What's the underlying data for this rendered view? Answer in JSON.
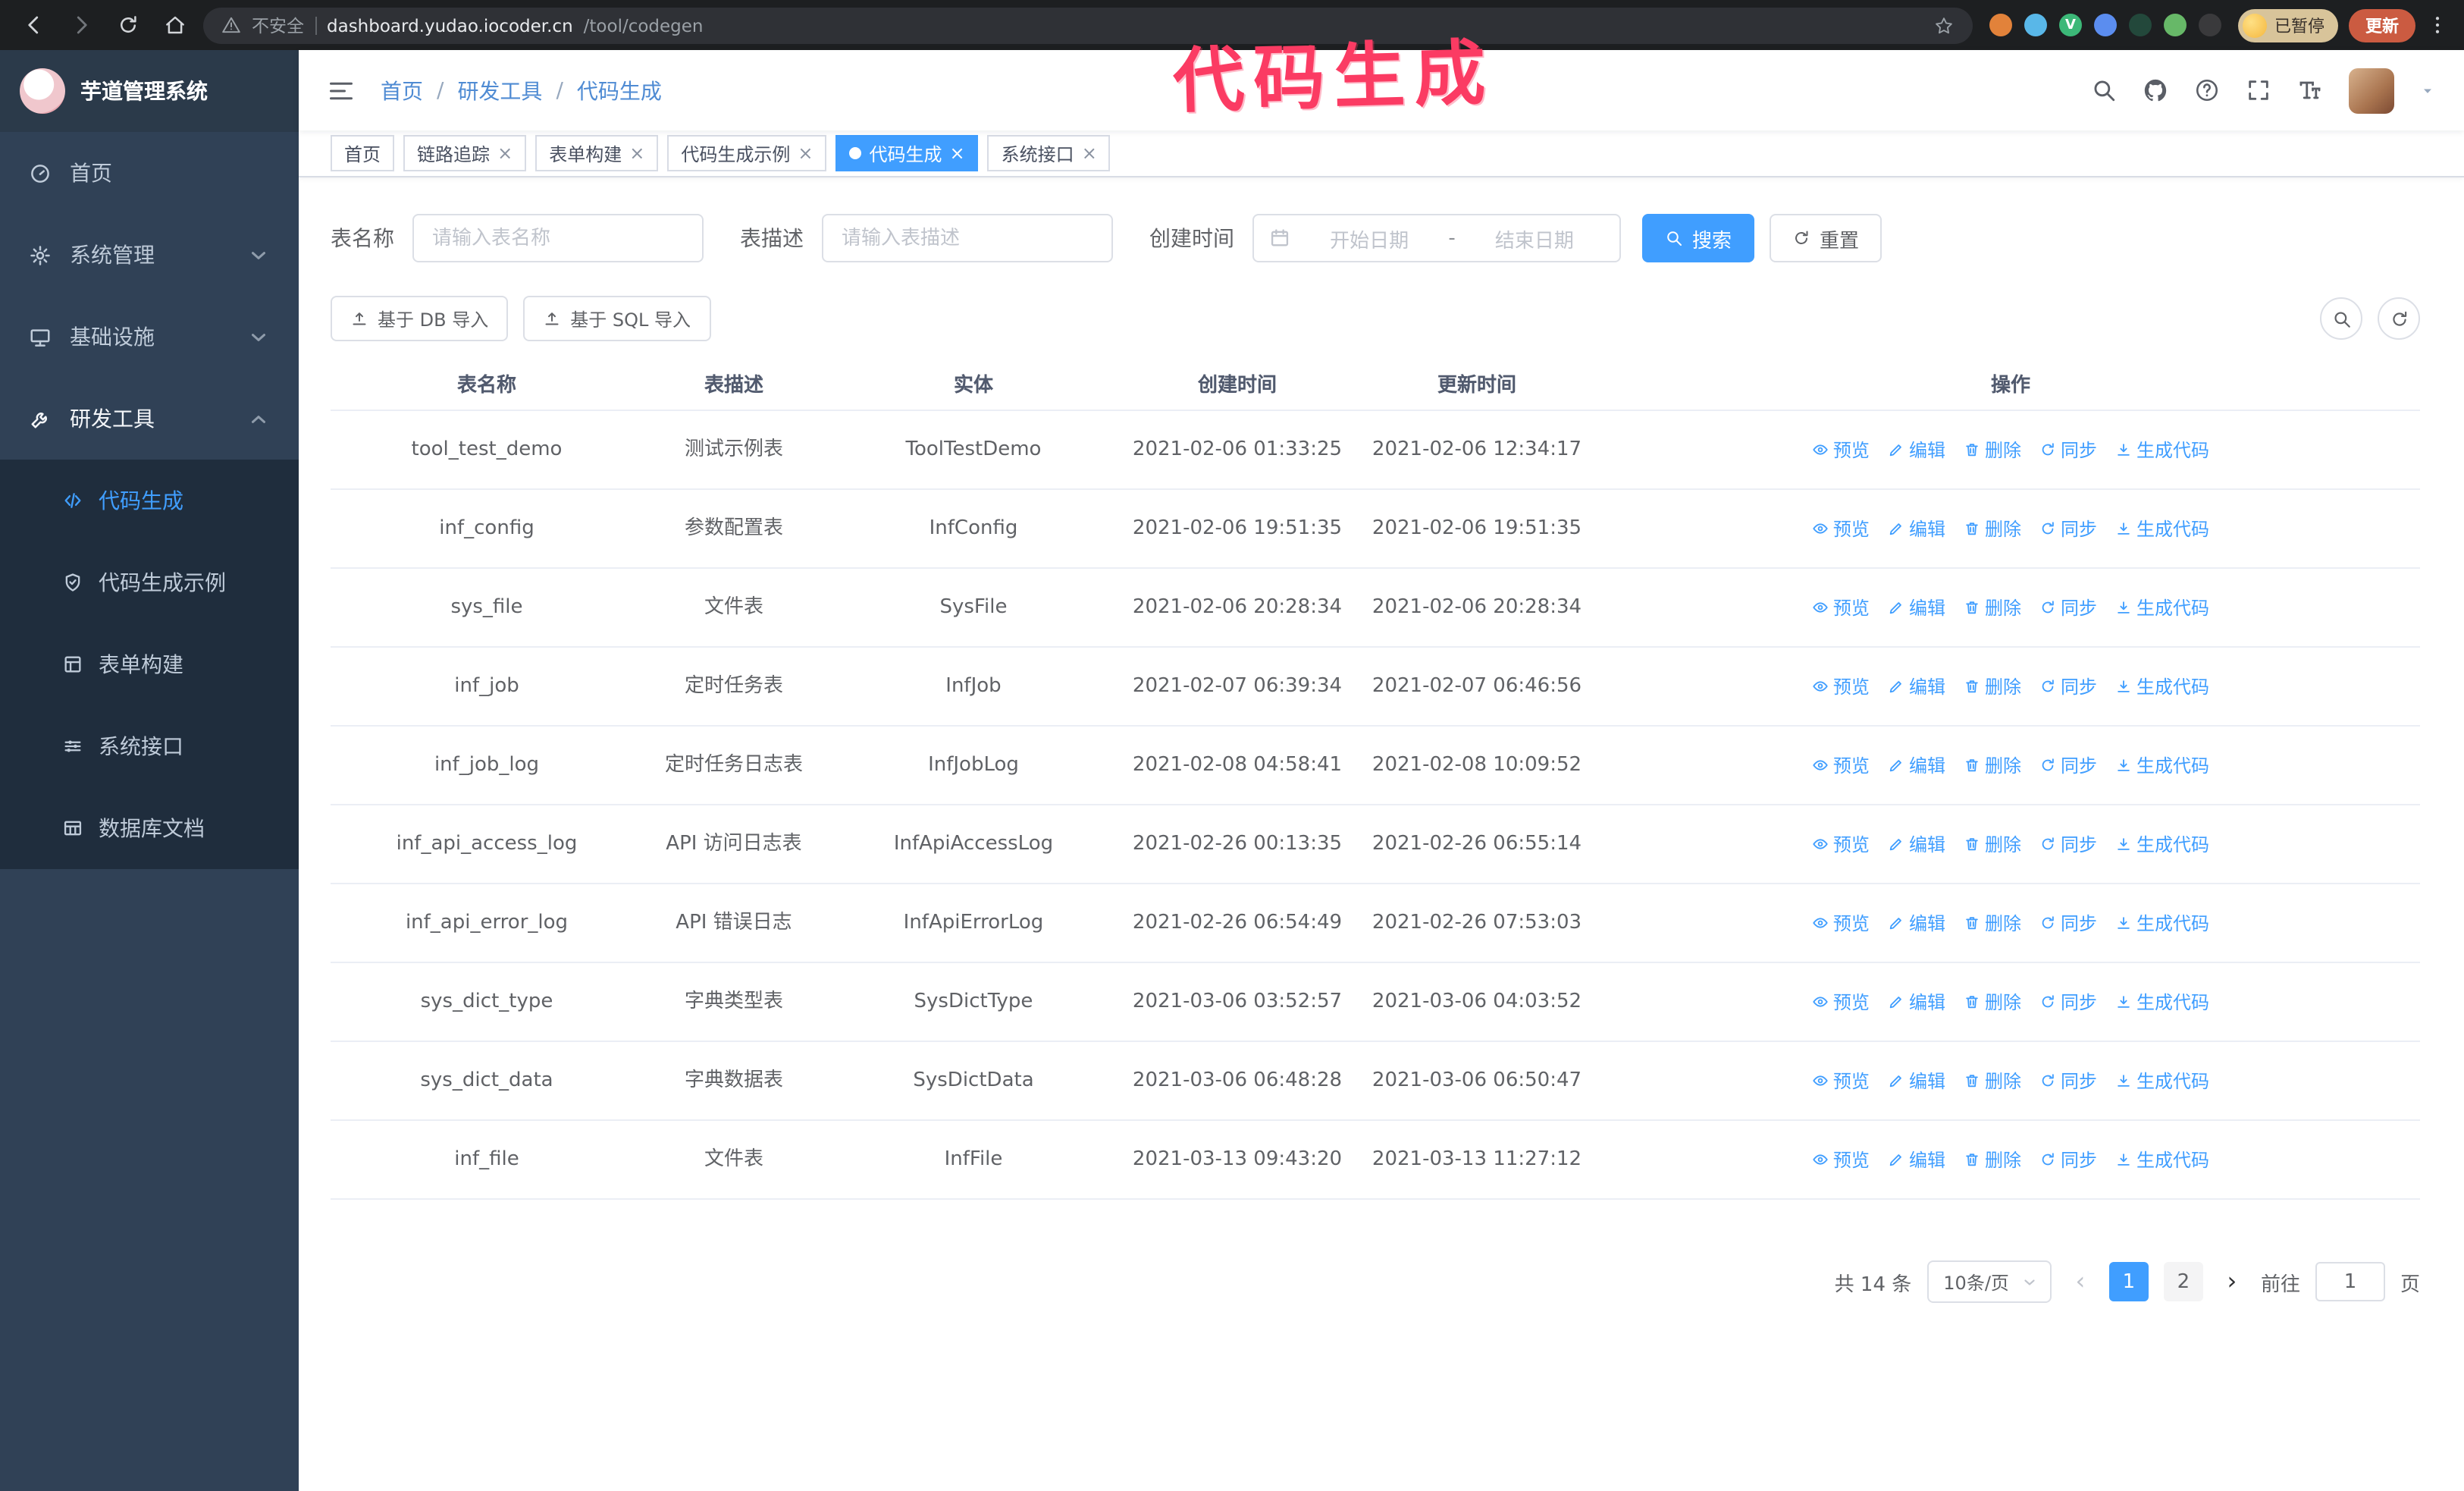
{
  "theme": {
    "accent": "#409eff",
    "sidebar_bg": "#304156",
    "submenu_bg": "#1f2d3d",
    "annotation_color": "#fb3b63"
  },
  "annotation": {
    "text": "代码生成"
  },
  "browser": {
    "security_label": "不安全",
    "url_host": "dashboard.yudao.iocoder.cn",
    "url_path": "/tool/codegen",
    "profile_badge": "已暂停",
    "update_button": "更新",
    "extensions": [
      {
        "name": "fox",
        "color": "#e2823a",
        "glyph": ""
      },
      {
        "name": "drop",
        "color": "#59b7e8",
        "glyph": ""
      },
      {
        "name": "v-circle",
        "color": "#3cb878",
        "glyph": "V"
      },
      {
        "name": "grid",
        "color": "#5b8def",
        "glyph": ""
      },
      {
        "name": "capture",
        "color": "#23483b",
        "glyph": ""
      },
      {
        "name": "leaf",
        "color": "#67b868",
        "glyph": ""
      },
      {
        "name": "pin",
        "color": "#3a3a3c",
        "glyph": ""
      }
    ]
  },
  "sidebar": {
    "logo_title": "芋道管理系统",
    "menu": [
      {
        "label": "首页"
      },
      {
        "label": "系统管理"
      },
      {
        "label": "基础设施"
      },
      {
        "label": "研发工具"
      }
    ],
    "submenu": [
      {
        "label": "代码生成",
        "active": true
      },
      {
        "label": "代码生成示例"
      },
      {
        "label": "表单构建"
      },
      {
        "label": "系统接口"
      },
      {
        "label": "数据库文档"
      }
    ]
  },
  "navbar": {
    "breadcrumb": [
      "首页",
      "研发工具",
      "代码生成"
    ],
    "separator": "/"
  },
  "tabs": [
    {
      "label": "首页"
    },
    {
      "label": "链路追踪"
    },
    {
      "label": "表单构建"
    },
    {
      "label": "代码生成示例"
    },
    {
      "label": "代码生成",
      "active": true
    },
    {
      "label": "系统接口"
    }
  ],
  "filters": {
    "table_name_label": "表名称",
    "table_name_placeholder": "请输入表名称",
    "table_desc_label": "表描述",
    "table_desc_placeholder": "请输入表描述",
    "create_time_label": "创建时间",
    "date_start_placeholder": "开始日期",
    "date_separator": "-",
    "date_end_placeholder": "结束日期",
    "search_button": "搜索",
    "reset_button": "重置"
  },
  "toolbar": {
    "import_db_button": "基于 DB 导入",
    "import_sql_button": "基于 SQL 导入"
  },
  "table": {
    "columns": [
      "表名称",
      "表描述",
      "实体",
      "创建时间",
      "更新时间",
      "操作"
    ],
    "actions": [
      "预览",
      "编辑",
      "删除",
      "同步",
      "生成代码"
    ],
    "rows": [
      {
        "name": "tool_test_demo",
        "desc": "测试示例表",
        "entity": "ToolTestDemo",
        "created": "2021-02-06 01:33:25",
        "updated": "2021-02-06 12:34:17",
        "created_wrap": false,
        "updated_wrap": false
      },
      {
        "name": "inf_config",
        "desc": "参数配置表",
        "entity": "InfConfig",
        "created": "2021-02-06 19:51:35",
        "updated": "2021-02-06 19:51:35",
        "created_wrap": false,
        "updated_wrap": false
      },
      {
        "name": "sys_file",
        "desc": "文件表",
        "entity": "SysFile",
        "created": "2021-02-06 20:28:34",
        "updated": "2021-02-06 20:28:34",
        "created_wrap": true,
        "updated_wrap": true
      },
      {
        "name": "inf_job",
        "desc": "定时任务表",
        "entity": "InfJob",
        "created": "2021-02-07 06:39:34",
        "updated": "2021-02-07 06:46:56",
        "created_wrap": true,
        "updated_wrap": true
      },
      {
        "name": "inf_job_log",
        "desc": "定时任务日志表",
        "entity": "InfJobLog",
        "created": "2021-02-08 04:58:41",
        "updated": "2021-02-08 10:09:52",
        "created_wrap": true,
        "updated_wrap": true
      },
      {
        "name": "inf_api_access_log",
        "desc": "API 访问日志表",
        "entity": "InfApiAccessLog",
        "created": "2021-02-26 00:13:35",
        "updated": "2021-02-26 06:55:14",
        "created_wrap": false,
        "updated_wrap": true
      },
      {
        "name": "inf_api_error_log",
        "desc": "API 错误日志",
        "entity": "InfApiErrorLog",
        "created": "2021-02-26 06:54:49",
        "updated": "2021-02-26 07:53:03",
        "created_wrap": true,
        "updated_wrap": true
      },
      {
        "name": "sys_dict_type",
        "desc": "字典类型表",
        "entity": "SysDictType",
        "created": "2021-03-06 03:52:57",
        "updated": "2021-03-06 04:03:52",
        "created_wrap": true,
        "updated_wrap": true
      },
      {
        "name": "sys_dict_data",
        "desc": "字典数据表",
        "entity": "SysDictData",
        "created": "2021-03-06 06:48:28",
        "updated": "2021-03-06 06:50:47",
        "created_wrap": true,
        "updated_wrap": true
      },
      {
        "name": "inf_file",
        "desc": "文件表",
        "entity": "InfFile",
        "created": "2021-03-13 09:43:20",
        "updated": "2021-03-13 11:27:12",
        "created_wrap": true,
        "updated_wrap": false
      }
    ]
  },
  "pagination": {
    "total_label": "共 14 条",
    "page_size": "10条/页",
    "prev": "‹",
    "next": "›",
    "pages": [
      "1",
      "2"
    ],
    "active_page": "1",
    "goto_label": "前往",
    "goto_value": "1",
    "goto_unit": "页"
  }
}
